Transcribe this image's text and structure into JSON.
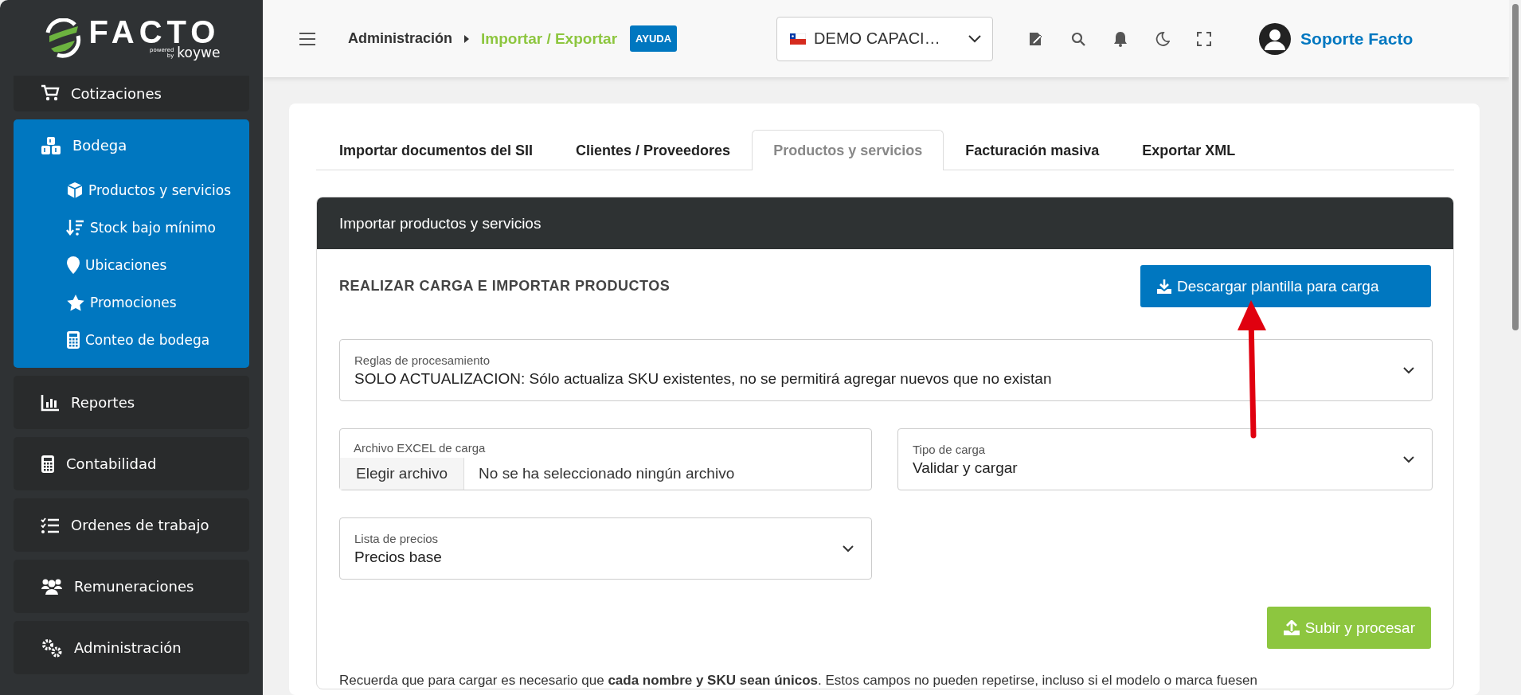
{
  "logo": {
    "name": "FACTO",
    "powered": "powered",
    "by": "by",
    "brand": "koywe"
  },
  "sidebar": {
    "items": [
      {
        "label": "Cotizaciones",
        "expanded": false
      },
      {
        "label": "Bodega",
        "expanded": true,
        "children": [
          {
            "label": "Productos y servicios"
          },
          {
            "label": "Stock bajo mínimo"
          },
          {
            "label": "Ubicaciones"
          },
          {
            "label": "Promociones"
          },
          {
            "label": "Conteo de bodega"
          }
        ]
      },
      {
        "label": "Reportes",
        "expanded": false
      },
      {
        "label": "Contabilidad",
        "expanded": false
      },
      {
        "label": "Ordenes de trabajo",
        "expanded": false
      },
      {
        "label": "Remuneraciones",
        "expanded": false
      },
      {
        "label": "Administración",
        "expanded": false
      }
    ]
  },
  "header": {
    "breadcrumb": [
      {
        "label": "Administración",
        "current": false
      },
      {
        "label": "Importar / Exportar",
        "current": true
      }
    ],
    "help": "AYUDA",
    "company": "DEMO CAPACI…",
    "user": "Soporte Facto"
  },
  "tabs": [
    {
      "label": "Importar documentos del SII",
      "selected": false
    },
    {
      "label": "Clientes / Proveedores",
      "selected": false
    },
    {
      "label": "Productos y servicios",
      "selected": true
    },
    {
      "label": "Facturación masiva",
      "selected": false
    },
    {
      "label": "Exportar XML",
      "selected": false
    }
  ],
  "panel": {
    "title": "Importar productos y servicios",
    "section_title": "REALIZAR CARGA E IMPORTAR PRODUCTOS",
    "download_button": "Descargar plantilla para carga",
    "fields": [
      {
        "kind": "select",
        "label": "Reglas de procesamiento",
        "value": "SOLO ACTUALIZACION: Sólo actualiza SKU existentes, no se permitirá agregar nuevos que no existan"
      },
      {
        "kind": "file",
        "label": "Archivo EXCEL de carga",
        "button": "Elegir archivo",
        "value": "No se ha seleccionado ningún archivo"
      },
      {
        "kind": "select",
        "label": "Tipo de carga",
        "value": "Validar y cargar"
      },
      {
        "kind": "select",
        "label": "Lista de precios",
        "value": "Precios base"
      }
    ],
    "submit_button": "Subir y procesar",
    "note": "Recuerda que para cargar es necesario que **cada nombre y SKU sean únicos**. Estos campos no pueden repetirse, incluso si el modelo o marca fuesen"
  }
}
